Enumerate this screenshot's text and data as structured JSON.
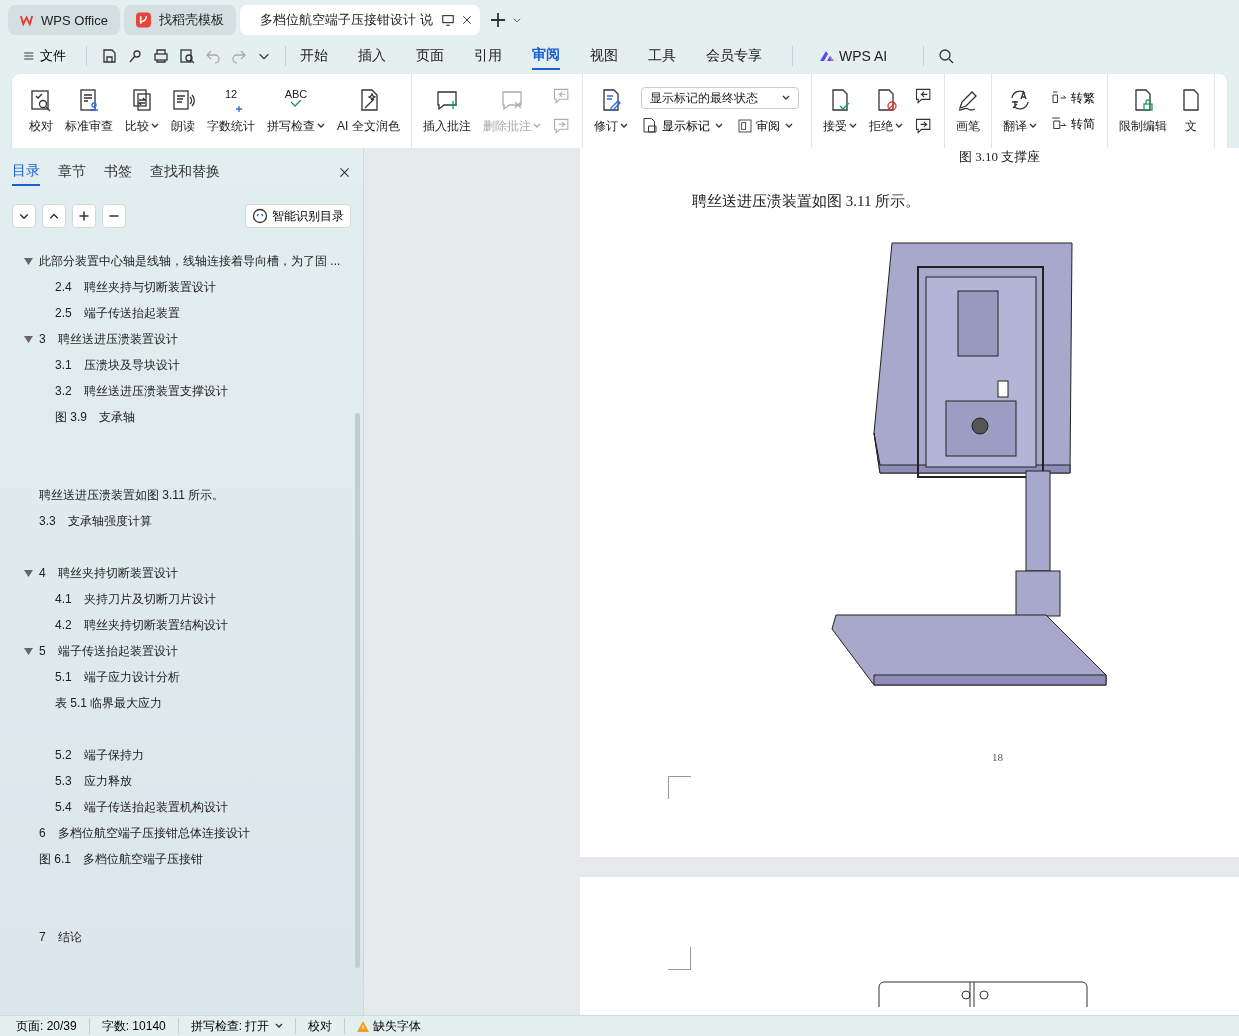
{
  "tabs": [
    {
      "label": "WPS Office",
      "kind": "wps",
      "selected": false
    },
    {
      "label": "找稻壳模板",
      "kind": "template",
      "selected": false
    },
    {
      "label": "多档位航空端子压接钳设计 说",
      "kind": "doc",
      "selected": true
    }
  ],
  "menu": {
    "file": "文件",
    "tabs": [
      {
        "label": "开始",
        "selected": false
      },
      {
        "label": "插入",
        "selected": false
      },
      {
        "label": "页面",
        "selected": false
      },
      {
        "label": "引用",
        "selected": false
      },
      {
        "label": "审阅",
        "selected": true
      },
      {
        "label": "视图",
        "selected": false
      },
      {
        "label": "工具",
        "selected": false
      },
      {
        "label": "会员专享",
        "selected": false
      }
    ],
    "ai": "WPS AI"
  },
  "ribbon": [
    [
      {
        "kind": "big",
        "label": "校对",
        "dropdown": false,
        "disabled": false
      },
      {
        "kind": "big",
        "label": "标准审查",
        "dropdown": false,
        "disabled": false
      },
      {
        "kind": "big",
        "label": "比较",
        "dropdown": true,
        "disabled": false
      },
      {
        "kind": "big",
        "label": "朗读",
        "dropdown": false,
        "disabled": false
      },
      {
        "kind": "big",
        "icon_text": "12",
        "label": "字数统计",
        "dropdown": false,
        "disabled": false
      },
      {
        "kind": "big",
        "icon_text": "ABC",
        "label": "拼写检查",
        "dropdown": true,
        "disabled": false
      },
      {
        "kind": "big",
        "label": "AI 全文润色",
        "dropdown": false,
        "disabled": false
      }
    ],
    [
      {
        "kind": "big",
        "label": "插入批注",
        "dropdown": false,
        "disabled": false
      },
      {
        "kind": "big",
        "label": "删除批注",
        "dropdown": true,
        "disabled": true
      },
      {
        "kind": "icons",
        "disabled": true
      }
    ],
    [
      {
        "kind": "big",
        "label": "修订",
        "dropdown": true,
        "disabled": false
      },
      {
        "kind": "markup",
        "value": "显示标记的最终状态",
        "buttons": [
          "显示标记",
          "审阅"
        ]
      }
    ],
    [
      {
        "kind": "big",
        "label": "接受",
        "dropdown": true,
        "disabled": false
      },
      {
        "kind": "big",
        "label": "拒绝",
        "dropdown": true,
        "disabled": false
      },
      {
        "kind": "icons",
        "disabled": false
      }
    ],
    [
      {
        "kind": "big",
        "label": "画笔",
        "dropdown": false,
        "disabled": false
      }
    ],
    [
      {
        "kind": "big",
        "label": "翻译",
        "dropdown": true,
        "disabled": false
      },
      {
        "kind": "labels",
        "items": [
          "转繁",
          "转简"
        ]
      }
    ],
    [
      {
        "kind": "big",
        "label": "限制编辑",
        "dropdown": false,
        "disabled": false
      },
      {
        "kind": "big",
        "label": "文",
        "dropdown": false,
        "disabled": false
      }
    ]
  ],
  "sidebar": {
    "tabs": [
      {
        "label": "目录",
        "selected": true
      },
      {
        "label": "章节",
        "selected": false
      },
      {
        "label": "书签",
        "selected": false
      },
      {
        "label": "查找和替换",
        "selected": false
      }
    ],
    "smart_button": "智能识别目录",
    "toc": [
      {
        "title": "此部分装置中心轴是线轴，线轴连接着导向槽，为了固 ...",
        "expanded": true,
        "children": [
          {
            "number": "2.4",
            "title": "聘丝夹持与切断装置设计"
          },
          {
            "number": "2.5",
            "title": "端子传送抬起装置"
          }
        ]
      },
      {
        "number": "3",
        "title": "聘丝送进压溃装置设计",
        "expanded": true,
        "children": [
          {
            "number": "3.1",
            "title": "压溃块及导块设计"
          },
          {
            "number": "3.2",
            "title": "聘丝送进压溃装置支撑设计"
          },
          {
            "number": "图 3.9",
            "title": "支承轴"
          }
        ]
      },
      {
        "title": "聘丝送进压溃装置如图 3.11 所示。",
        "gap_before": true,
        "double_gap": true
      },
      {
        "number": "3.3",
        "title": "支承轴强度计算"
      },
      {
        "number": "4",
        "title": "聘丝夹持切断装置设计",
        "expanded": true,
        "gap_before": true,
        "children": [
          {
            "number": "4.1",
            "title": "夹持刀片及切断刀片设计"
          },
          {
            "number": "4.2",
            "title": "聘丝夹持切断装置结构设计"
          }
        ]
      },
      {
        "number": "5",
        "title": "端子传送抬起装置设计",
        "expanded": true,
        "children": [
          {
            "number": "5.1",
            "title": "端子应力设计分析"
          },
          {
            "title": "表 5.1 临界最大应力"
          },
          {
            "number": "5.2",
            "title": "端子保持力",
            "gap_before": true
          },
          {
            "number": "5.3",
            "title": "应力释放"
          },
          {
            "number": "5.4",
            "title": "端子传送抬起装置机构设计"
          }
        ]
      },
      {
        "number": "6",
        "title": "多档位航空端子压接钳总体连接设计"
      },
      {
        "number": "图 6.1",
        "title": "多档位航空端子压接钳"
      },
      {
        "number": "7",
        "title": "结论",
        "gap_before": true,
        "double_gap": true
      }
    ]
  },
  "document": {
    "caption": "图 3.10   支撑座",
    "paragraph": "聘丝送进压溃装置如图 3.11 所示。",
    "page_number": "18"
  },
  "status_bar": [
    {
      "kind": "text",
      "label": "页面: 20/39"
    },
    {
      "kind": "text",
      "label": "字数: 10140"
    },
    {
      "kind": "dropdown",
      "label": "拼写检查: 打开"
    },
    {
      "kind": "text",
      "label": "校对"
    },
    {
      "kind": "warning",
      "label": "缺失字体"
    }
  ]
}
